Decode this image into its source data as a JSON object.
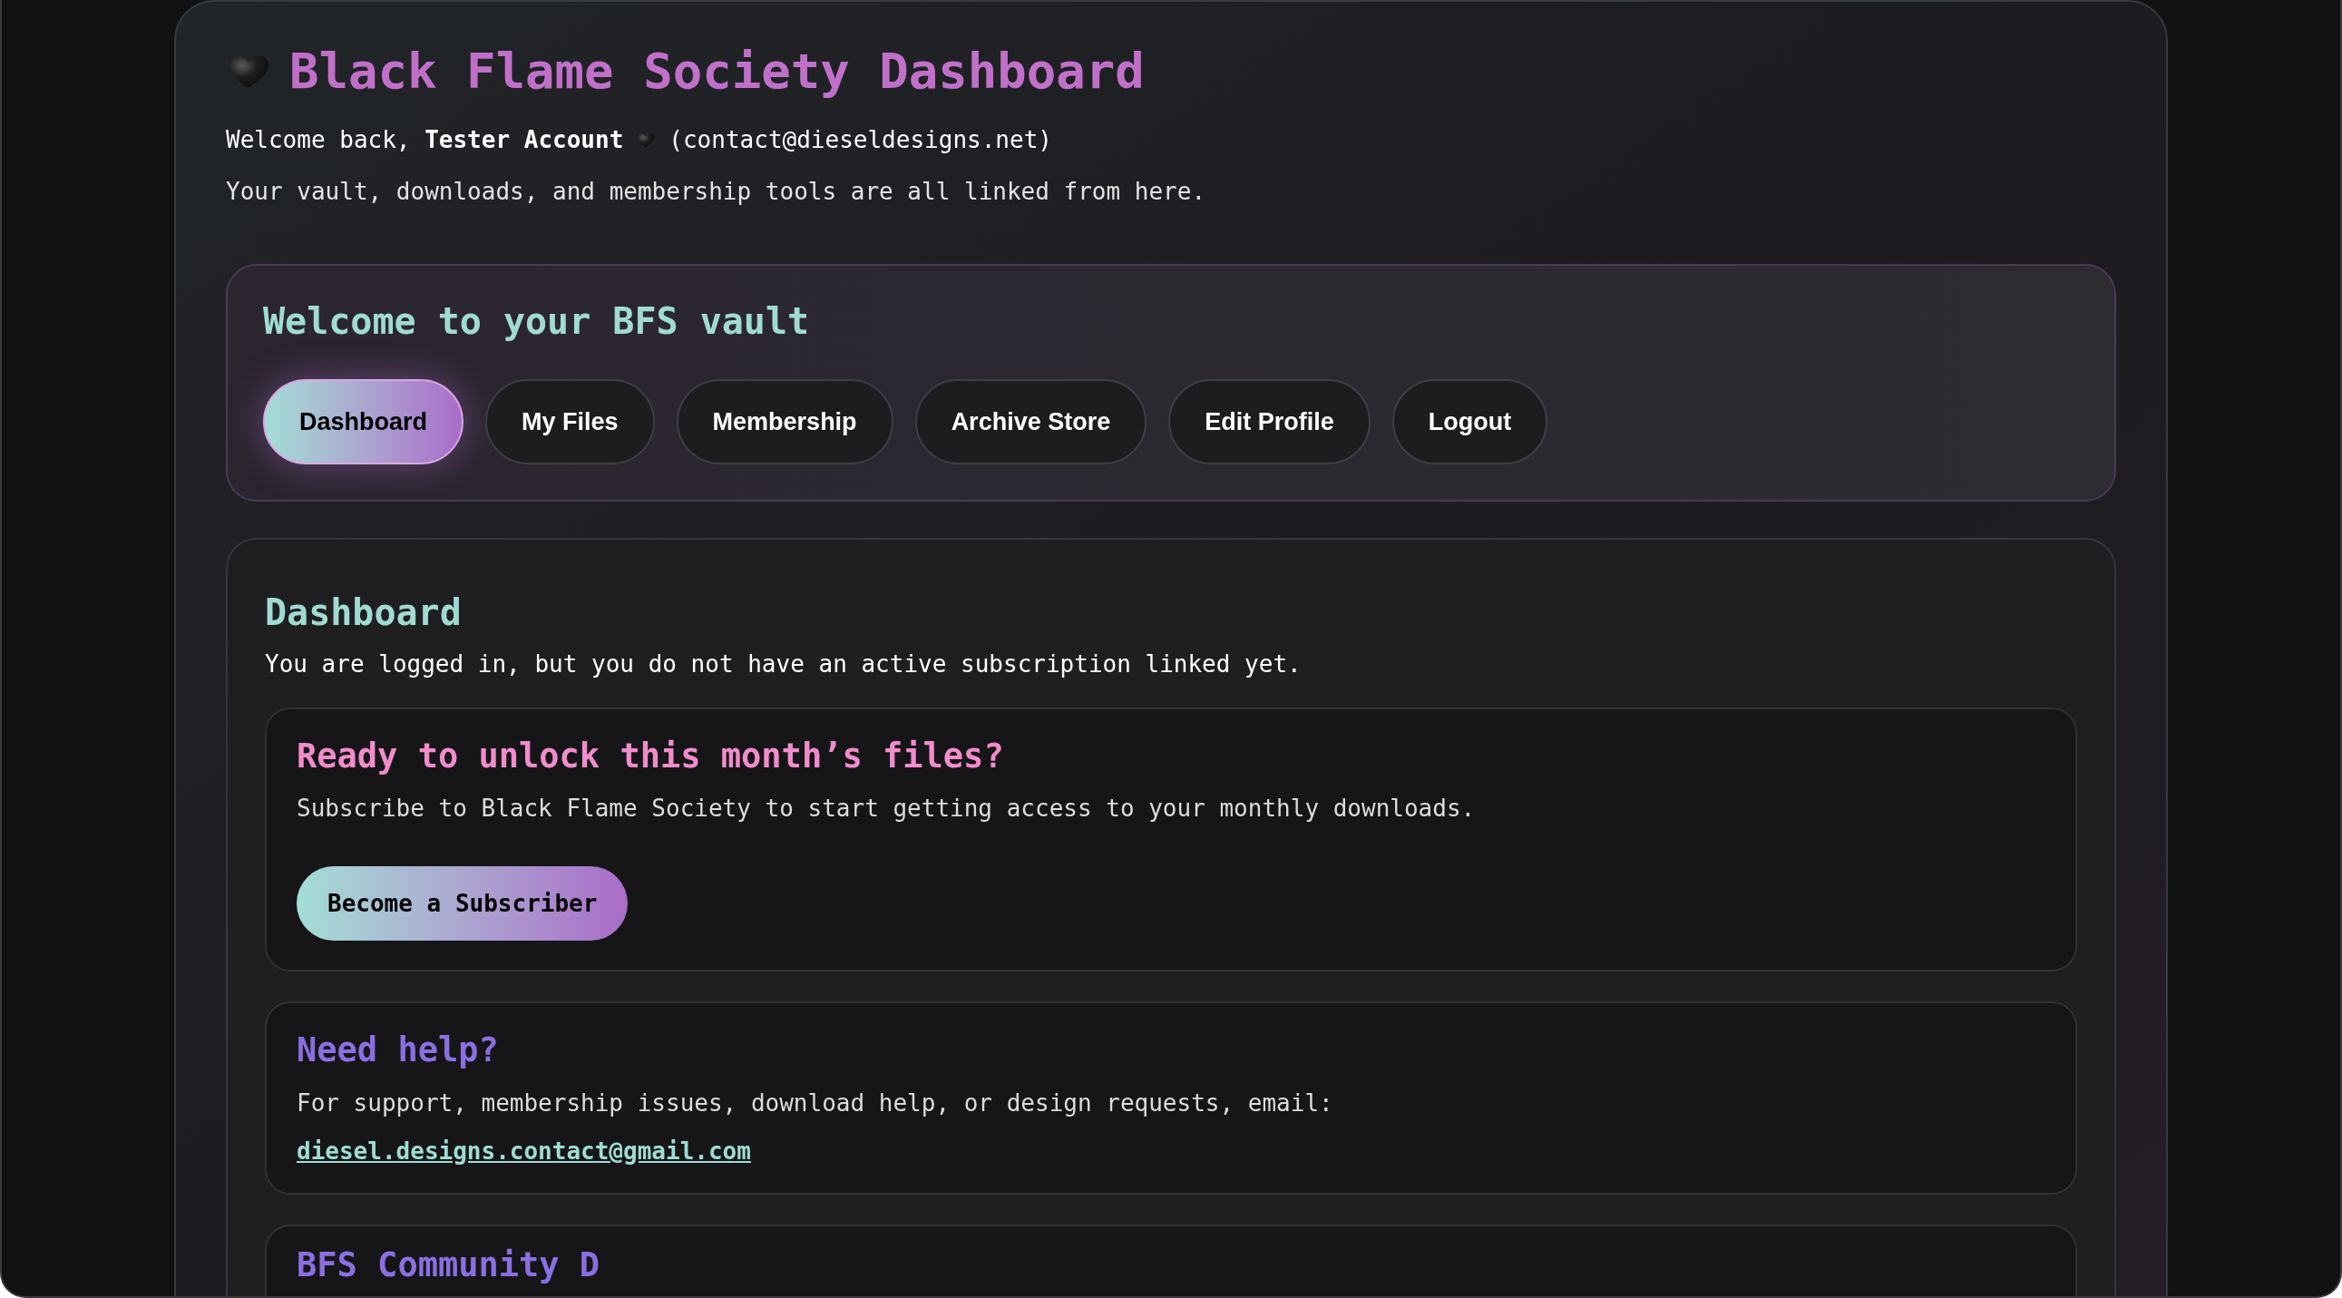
{
  "header": {
    "title": "Black Flame Society Dashboard",
    "greeting": "Welcome back, **Tester Account**",
    "email": "(contact@dieseldesigns.net)",
    "subtitle": "Your vault, downloads, and membership tools are all linked from here."
  },
  "nav": {
    "title": "Welcome to your BFS vault",
    "tabs": [
      {
        "label": "Dashboard",
        "selected": true
      },
      {
        "label": "My Files",
        "selected": false
      },
      {
        "label": "Membership",
        "selected": false
      },
      {
        "label": "Archive Store",
        "selected": false
      },
      {
        "label": "Edit Profile",
        "selected": false
      },
      {
        "label": "Logout",
        "selected": false
      }
    ]
  },
  "content": {
    "heading": "Dashboard",
    "status": "You are logged in, but you do not have an active subscription linked yet.",
    "cards": [
      {
        "kind": "cta",
        "title": "Ready to unlock this month’s files?",
        "text": "Subscribe to Black Flame Society to start getting access to your monthly downloads.",
        "button": "Become a Subscriber"
      },
      {
        "kind": "contact",
        "title": "Need help?",
        "text": "For support, membership issues, download help, or design requests, email:",
        "link": "diesel.designs.contact@gmail.com"
      },
      {
        "kind": "partial",
        "title": "BFS Community D"
      }
    ]
  }
}
